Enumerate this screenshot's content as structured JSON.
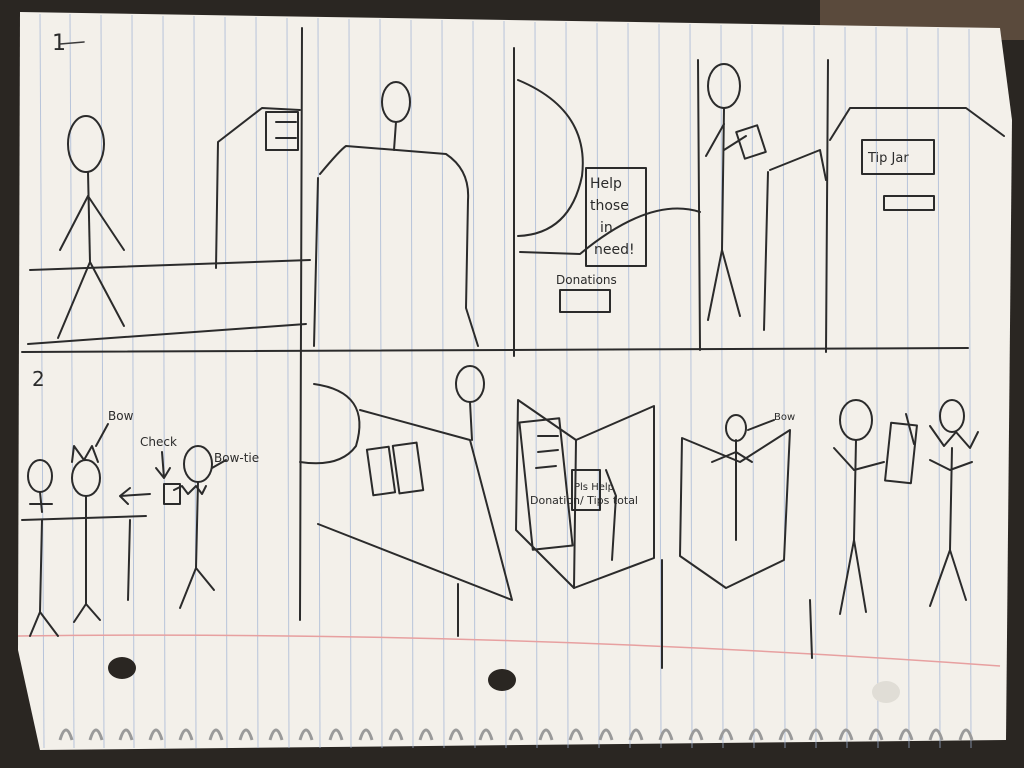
{
  "scene": {
    "description_free": true,
    "colors": {
      "paper": "#f3f0ea",
      "rule_line": "#9fb2d4",
      "margin_line": "#e7a0a0",
      "ink": "#2b2b2b",
      "background": "#2a2622"
    }
  },
  "rows": [
    {
      "number": "1"
    },
    {
      "number": "2"
    }
  ],
  "row1": {
    "panel3_sign": {
      "line1": "Help",
      "line2": "those",
      "line3": "in",
      "line4": "need!",
      "line5": "Donations"
    },
    "panel5_sign": "Tip Jar"
  },
  "row2": {
    "panel1": {
      "label_bow": "Bow",
      "label_check": "Check",
      "label_bowtie": "Bow-tie"
    },
    "panel3_page": {
      "left_text": "Donation/ Tips total",
      "right_text": "Pls Help"
    },
    "panel4_label": "Bow"
  }
}
